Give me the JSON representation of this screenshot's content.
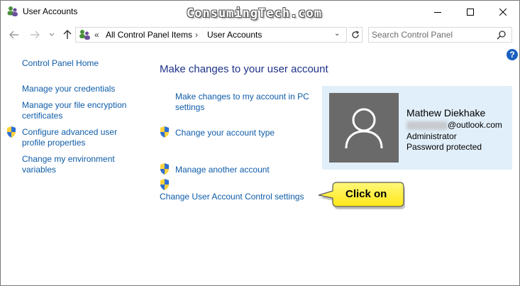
{
  "window": {
    "title": "User Accounts",
    "watermark": "ConsumingTech.com",
    "icon": "user-accounts-icon",
    "controls": {
      "minimize": "minimize-icon",
      "maximize": "maximize-icon",
      "close": "close-icon"
    }
  },
  "address": {
    "overflow": "«",
    "crumbs": [
      "All Control Panel Items",
      "User Accounts"
    ],
    "separator": "›",
    "search_placeholder": "Search Control Panel"
  },
  "help": {
    "label": "?"
  },
  "left_nav": {
    "home": "Control Panel Home",
    "items": [
      {
        "label": "Manage your credentials",
        "shield": false
      },
      {
        "label": "Manage your file encryption certificates",
        "shield": false
      },
      {
        "label": "Configure advanced user profile properties",
        "shield": true
      },
      {
        "label": "Change my environment variables",
        "shield": false
      }
    ]
  },
  "main": {
    "heading": "Make changes to your user account",
    "tasks": [
      {
        "label": "Make changes to my account in PC settings",
        "shield": false
      },
      {
        "label": "Change your account type",
        "shield": true
      },
      {
        "label": "Manage another account",
        "shield": true
      },
      {
        "label": "Change User Account Control settings",
        "shield": true
      }
    ]
  },
  "user": {
    "name": "Mathew Diekhake",
    "email_domain": "@outlook.com",
    "role": "Administrator",
    "status": "Password protected"
  },
  "callout": {
    "text": "Click on"
  },
  "colors": {
    "link": "#0e5ca8",
    "heading": "#1e3287",
    "card_bg": "#e1effa",
    "callout_fill": "#fff34a"
  }
}
